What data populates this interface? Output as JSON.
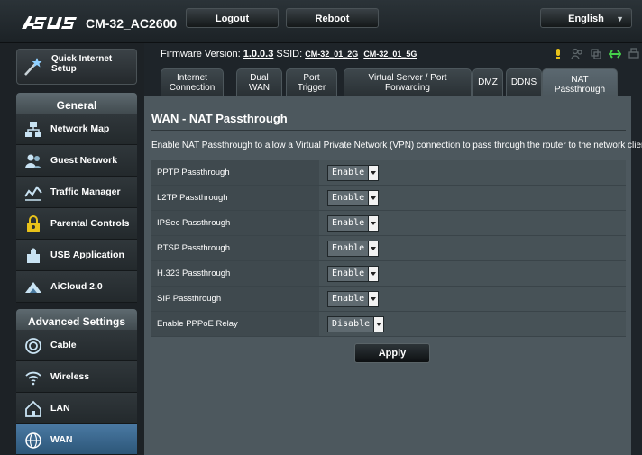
{
  "header": {
    "brand": "/ISUS",
    "model": "CM-32_AC2600",
    "logout_label": "Logout",
    "reboot_label": "Reboot",
    "language": "English"
  },
  "info": {
    "firmware_label": "Firmware Version:",
    "firmware_value": "1.0.0.3",
    "ssid_label": "SSID:",
    "ssid_2g": "CM-32_01_2G",
    "ssid_5g": "CM-32_01_5G"
  },
  "sidebar": {
    "quick_setup_line1": "Quick Internet",
    "quick_setup_line2": "Setup",
    "general_label": "General",
    "general_items": [
      {
        "label": "Network Map",
        "icon": "network-map-icon"
      },
      {
        "label": "Guest Network",
        "icon": "guest-network-icon"
      },
      {
        "label": "Traffic Manager",
        "icon": "traffic-manager-icon"
      },
      {
        "label": "Parental Controls",
        "icon": "parental-controls-icon"
      },
      {
        "label": "USB Application",
        "icon": "usb-application-icon"
      },
      {
        "label": "AiCloud 2.0",
        "icon": "aicloud-icon"
      }
    ],
    "advanced_label": "Advanced Settings",
    "advanced_items": [
      {
        "label": "Cable",
        "icon": "cable-icon"
      },
      {
        "label": "Wireless",
        "icon": "wireless-icon"
      },
      {
        "label": "LAN",
        "icon": "lan-icon"
      },
      {
        "label": "WAN",
        "icon": "wan-icon",
        "active": true
      }
    ]
  },
  "tabs": [
    {
      "line1": "Internet",
      "line2": "Connection"
    },
    {
      "line1": "Dual",
      "line2": "WAN"
    },
    {
      "line1": "Port",
      "line2": "Trigger"
    },
    {
      "line1": "Virtual Server / Port",
      "line2": "Forwarding"
    },
    {
      "line1": "DMZ",
      "line2": ""
    },
    {
      "line1": "DDNS",
      "line2": ""
    },
    {
      "line1": "NAT",
      "line2": "Passthrough",
      "active": true
    }
  ],
  "main": {
    "title": "WAN - NAT Passthrough",
    "description": "Enable NAT Passthrough to allow a Virtual Private Network (VPN) connection to pass through the router to the network clients.",
    "settings": [
      {
        "label": "PPTP Passthrough",
        "value": "Enable"
      },
      {
        "label": "L2TP Passthrough",
        "value": "Enable"
      },
      {
        "label": "IPSec Passthrough",
        "value": "Enable"
      },
      {
        "label": "RTSP Passthrough",
        "value": "Enable"
      },
      {
        "label": "H.323 Passthrough",
        "value": "Enable"
      },
      {
        "label": "SIP Passthrough",
        "value": "Enable"
      },
      {
        "label": "Enable PPPoE Relay",
        "value": "Disable"
      }
    ],
    "apply_label": "Apply"
  },
  "colors": {
    "panel": "#4d585e",
    "active_menu": "#3d6a91",
    "status_yellow": "#e8c21a",
    "status_green": "#45d14a"
  }
}
